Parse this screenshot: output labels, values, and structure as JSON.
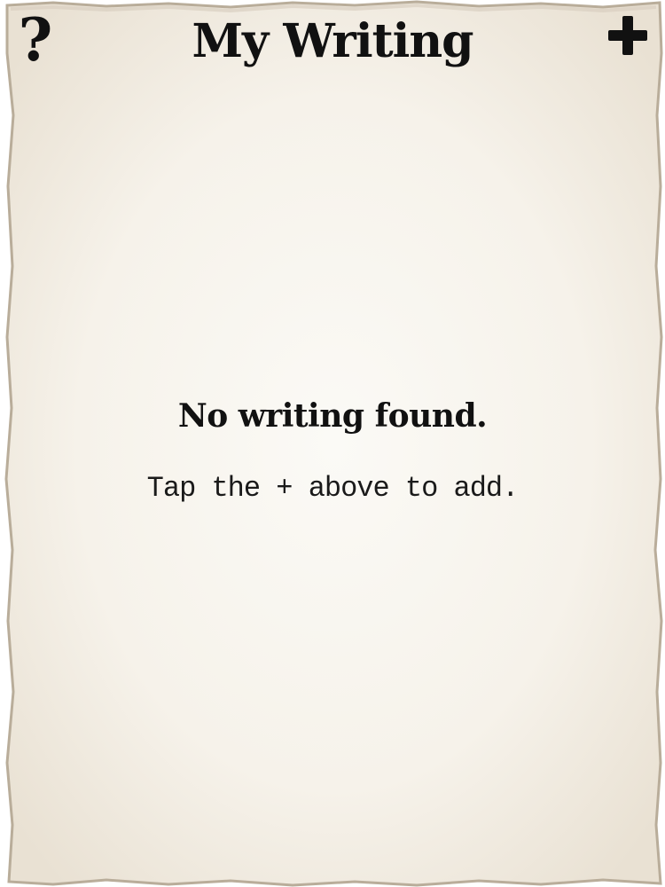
{
  "header": {
    "title": "My Writing",
    "help_icon": "question-mark-icon",
    "help_label": "?",
    "add_icon": "plus-icon"
  },
  "empty_state": {
    "heading": "No writing found.",
    "hint": "Tap the + above to add."
  },
  "colors": {
    "paper": "#f7f4ee",
    "paper_edge": "#cfc6b8",
    "text": "#111111"
  }
}
